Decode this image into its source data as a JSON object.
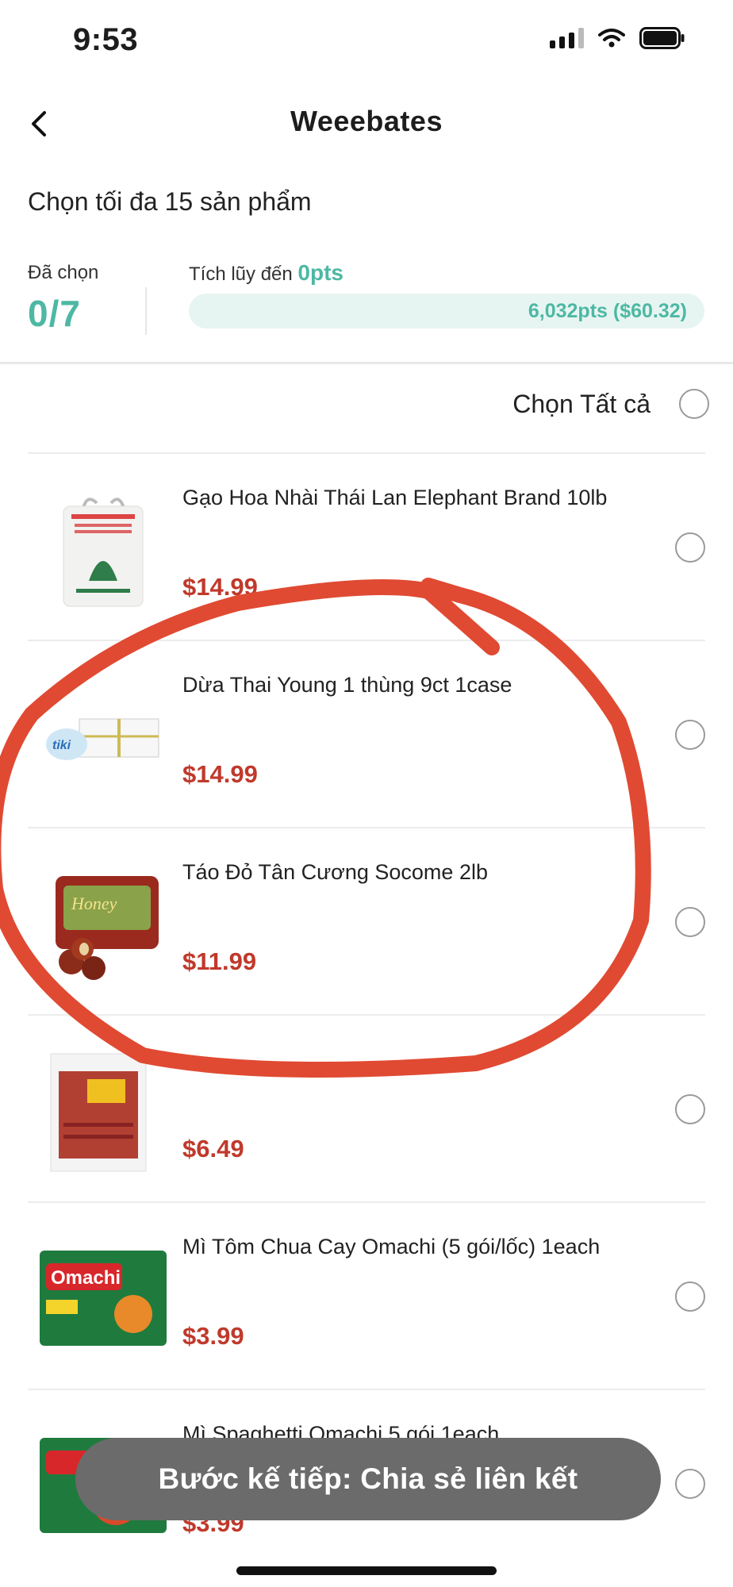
{
  "status_bar": {
    "time": "9:53"
  },
  "header": {
    "title": "Weeebates"
  },
  "instruction": "Chọn tối đa 15 sản phẩm",
  "summary": {
    "selected_label": "Đã chọn",
    "selected_count": "0/7",
    "accumulate_label": "Tích lũy đến ",
    "accumulate_points": "0pts",
    "progress_fraction": 0,
    "progress_target": "6,032pts ($60.32)"
  },
  "select_all_label": "Chọn Tất cả",
  "products": [
    {
      "name": "Gạo Hoa Nhài Thái Lan Elephant Brand 10lb",
      "price": "$14.99"
    },
    {
      "name": "Dừa Thai Young 1 thùng 9ct 1case",
      "price": "$14.99"
    },
    {
      "name": "Táo Đỏ Tân Cương Socome 2lb",
      "price": "$11.99"
    },
    {
      "name": "",
      "price": "$6.49"
    },
    {
      "name": "Mì Tôm Chua Cay Omachi (5 gói/lốc) 1each",
      "price": "$3.99"
    },
    {
      "name": "Mì Spaghetti Omachi 5 gói 1each",
      "price": "$3.99"
    }
  ],
  "next_button": "Bước kế tiếp: Chia sẻ liên kết",
  "colors": {
    "accent": "#4db8a3",
    "price": "#c0392b",
    "annotation": "#e04a32"
  }
}
